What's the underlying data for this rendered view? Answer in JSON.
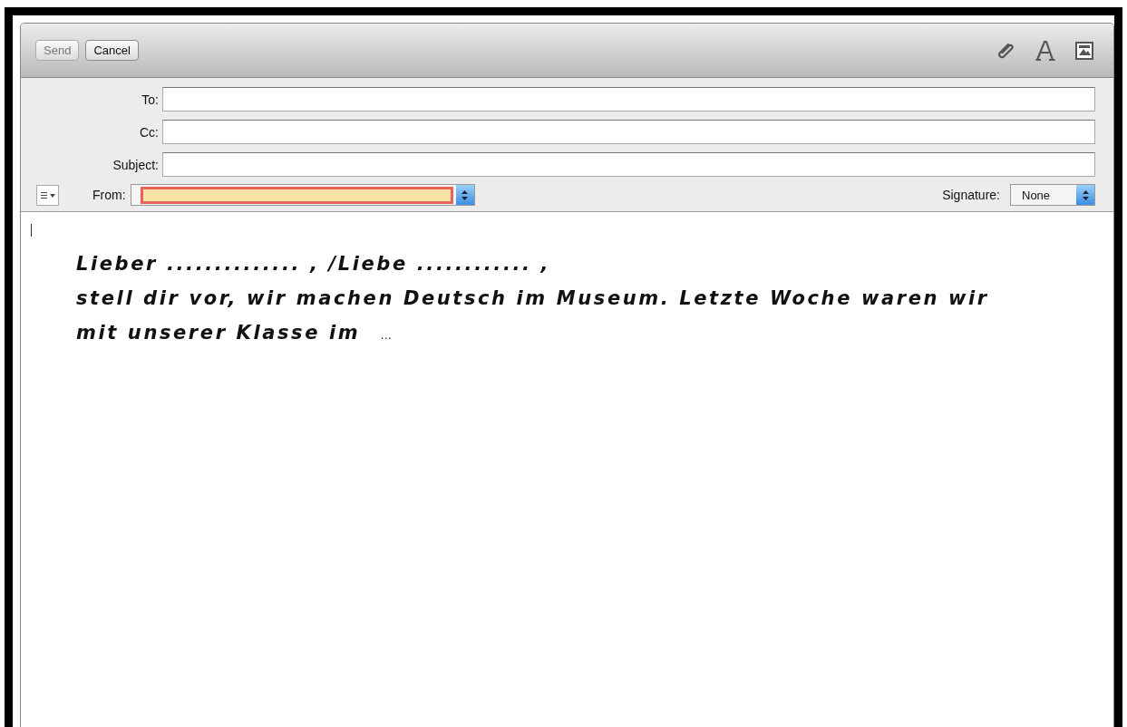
{
  "toolbar": {
    "buttons": [
      {
        "label": "Send",
        "disabled": true
      },
      {
        "label": "Cancel",
        "disabled": false
      }
    ]
  },
  "header_fields": [
    {
      "label": "To:"
    },
    {
      "label": "Cc:"
    },
    {
      "label": "Subject:"
    }
  ],
  "from": {
    "label": "From:"
  },
  "signature": {
    "label": "Signature:",
    "value": "None"
  },
  "body": {
    "lines": [
      "Lieber .............. , /Liebe ............ ,",
      "stell dir vor, wir machen Deutsch im Museum. Letzte Woche waren wir",
      "mit unserer Klasse im"
    ],
    "ellipsis": "…"
  }
}
